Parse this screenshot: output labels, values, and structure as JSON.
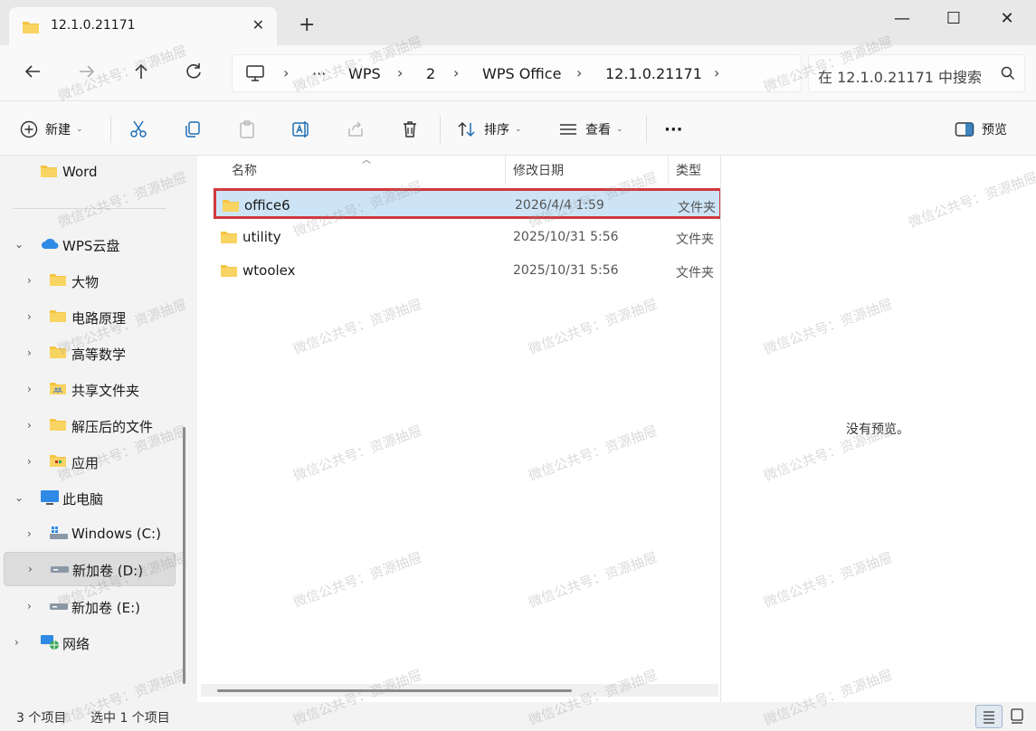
{
  "tab": {
    "title": "12.1.0.21171",
    "close": "✕",
    "new_tab": "+"
  },
  "window": {
    "minimize": "—",
    "maximize": "☐",
    "close": "✕"
  },
  "breadcrumb": {
    "more": "···",
    "items": [
      "WPS",
      "2",
      "WPS Office",
      "12.1.0.21171"
    ],
    "separator": "›"
  },
  "search": {
    "placeholder": "在 12.1.0.21171 中搜索"
  },
  "commands": {
    "new_label": "新建",
    "sort_label": "排序",
    "view_label": "查看",
    "more_label": "···",
    "preview_label": "预览"
  },
  "sidebar": {
    "items": [
      {
        "label": "Word",
        "icon": "folder-icon"
      },
      {
        "label": "WPS云盘",
        "icon": "cloud-icon"
      },
      {
        "label": "大物",
        "icon": "folder-icon"
      },
      {
        "label": "电路原理",
        "icon": "folder-icon"
      },
      {
        "label": "高等数学",
        "icon": "folder-icon"
      },
      {
        "label": "共享文件夹",
        "icon": "shared-folder-icon"
      },
      {
        "label": "解压后的文件",
        "icon": "folder-icon"
      },
      {
        "label": "应用",
        "icon": "app-folder-icon"
      },
      {
        "label": "此电脑",
        "icon": "computer-icon"
      },
      {
        "label": "Windows (C:)",
        "icon": "windows-drive-icon"
      },
      {
        "label": "新加卷 (D:)",
        "icon": "drive-icon"
      },
      {
        "label": "新加卷 (E:)",
        "icon": "drive-icon"
      },
      {
        "label": "网络",
        "icon": "network-icon"
      }
    ]
  },
  "columns": {
    "name": "名称",
    "modified": "修改日期",
    "type": "类型"
  },
  "files": [
    {
      "name": "office6",
      "modified": "2026/4/4 1:59",
      "type": "文件夹"
    },
    {
      "name": "utility",
      "modified": "2025/10/31 5:56",
      "type": "文件夹"
    },
    {
      "name": "wtoolex",
      "modified": "2025/10/31 5:56",
      "type": "文件夹"
    }
  ],
  "preview": {
    "message": "没有预览。"
  },
  "status": {
    "item_count": "3 个项目",
    "selected": "选中 1 个项目"
  },
  "watermark": "微信公共号：资源抽屉",
  "colors": {
    "accent": "#0067c0",
    "selection": "#cde4f7",
    "highlight_border": "#d0383d",
    "folder": "#f4c542"
  }
}
